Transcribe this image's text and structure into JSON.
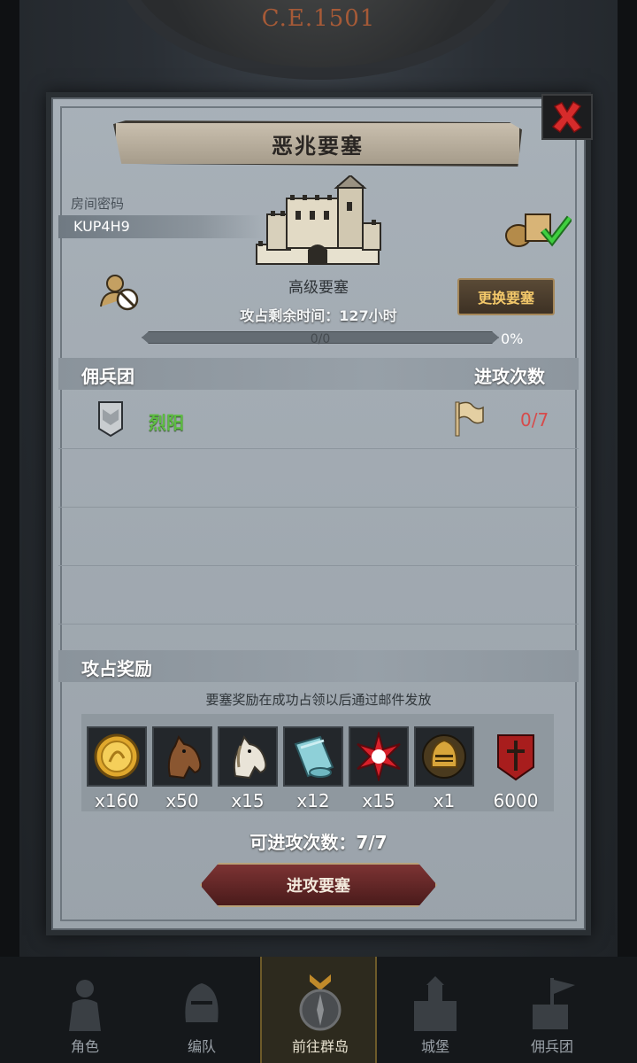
{
  "era": "C.E.1501",
  "dialog": {
    "title": "恶兆要塞",
    "room_code_label": "房间密码",
    "room_code": "KUP4H9",
    "fortress_level": "高级要塞",
    "change_button": "更换要塞",
    "capture_time": "攻占剩余时间：127小时",
    "progress": {
      "text": "0/0",
      "percent_label": "0%",
      "fraction": 0
    },
    "headers": {
      "mercenary": "佣兵团",
      "attack_count": "进攻次数"
    },
    "mercenaries": [
      {
        "name": "烈阳",
        "attacks": "0/7"
      }
    ],
    "reward_section": "攻占奖励",
    "reward_note": "要塞奖励在成功占领以后通过邮件发放",
    "rewards": [
      {
        "icon": "gold-coin-icon",
        "qty": "x160"
      },
      {
        "icon": "brown-horse-icon",
        "qty": "x50"
      },
      {
        "icon": "white-horse-icon",
        "qty": "x15"
      },
      {
        "icon": "cloth-roll-icon",
        "qty": "x12"
      },
      {
        "icon": "red-star-icon",
        "qty": "x15"
      },
      {
        "icon": "gold-helmet-icon",
        "qty": "x1"
      },
      {
        "icon": "sword-banner-icon",
        "qty": "6000"
      }
    ],
    "attempts": "可进攻次数：7/7",
    "attack_button": "进攻要塞"
  },
  "nav": [
    {
      "label": "角色",
      "icon": "knight-icon"
    },
    {
      "label": "编队",
      "icon": "helmet-icon"
    },
    {
      "label": "前往群岛",
      "icon": "compass-icon",
      "active": true
    },
    {
      "label": "城堡",
      "icon": "castle-icon"
    },
    {
      "label": "佣兵团",
      "icon": "mercenary-icon"
    }
  ],
  "colors": {
    "accent_gold": "#f3c86a",
    "merc_green": "#5dbc42",
    "count_red": "#d64b4b",
    "dialog_bg": "#a4adb5"
  }
}
